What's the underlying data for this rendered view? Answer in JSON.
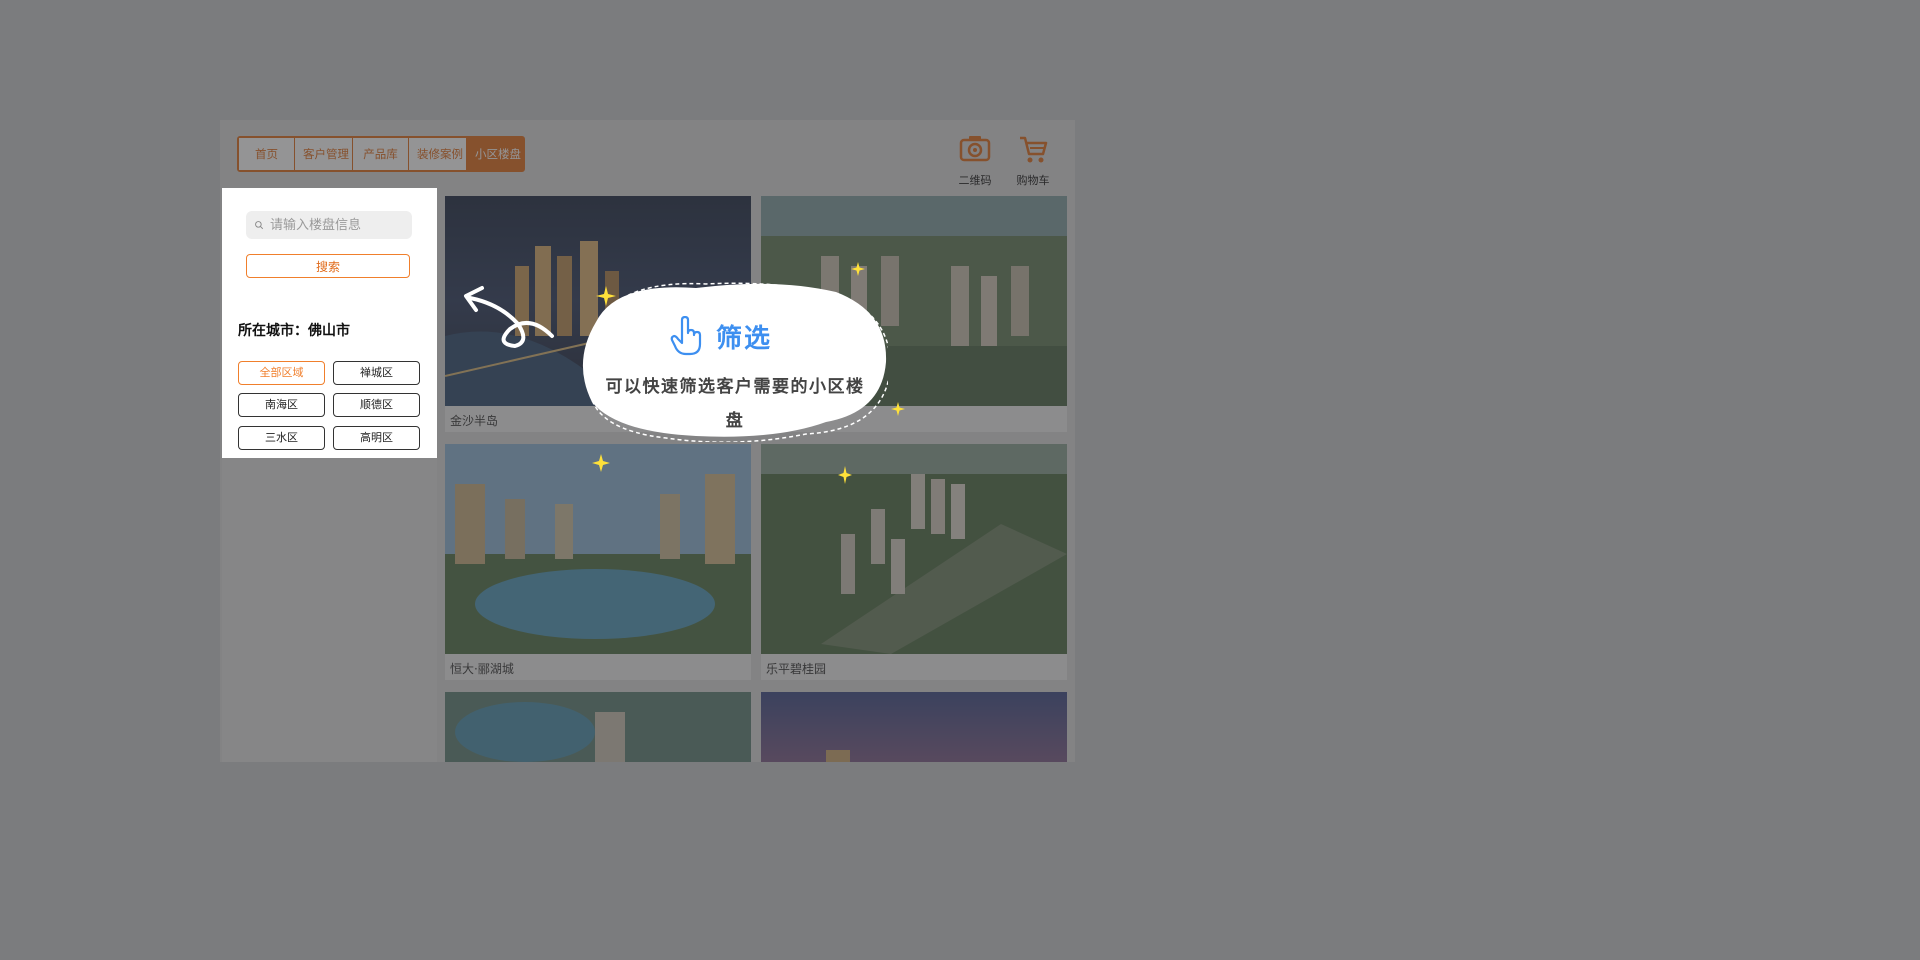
{
  "nav": {
    "items": [
      {
        "label": "首页",
        "active": false
      },
      {
        "label": "客户管理",
        "active": false
      },
      {
        "label": "产品库",
        "active": false
      },
      {
        "label": "装修案例",
        "active": false
      },
      {
        "label": "小区楼盘",
        "active": true
      }
    ]
  },
  "tools": {
    "qrcode_label": "二维码",
    "cart_label": "购物车"
  },
  "sidebar": {
    "search_placeholder": "请输入楼盘信息",
    "search_button": "搜索",
    "city_label": "所在城市：佛山市",
    "districts": [
      {
        "label": "全部区域",
        "active": true
      },
      {
        "label": "禅城区",
        "active": false
      },
      {
        "label": "南海区",
        "active": false
      },
      {
        "label": "顺德区",
        "active": false
      },
      {
        "label": "三水区",
        "active": false
      },
      {
        "label": "高明区",
        "active": false
      }
    ]
  },
  "listings": [
    {
      "name": "金沙半岛"
    },
    {
      "name": ""
    },
    {
      "name": "恒大·郦湖城"
    },
    {
      "name": "乐平碧桂园"
    },
    {
      "name": ""
    },
    {
      "name": ""
    }
  ],
  "tip": {
    "title": "筛选",
    "text": "可以快速筛选客户需要的小区楼盘"
  },
  "colors": {
    "accent": "#e06a1a",
    "tip_title": "#3d8ff0",
    "overlay": "#7b7c7e"
  }
}
